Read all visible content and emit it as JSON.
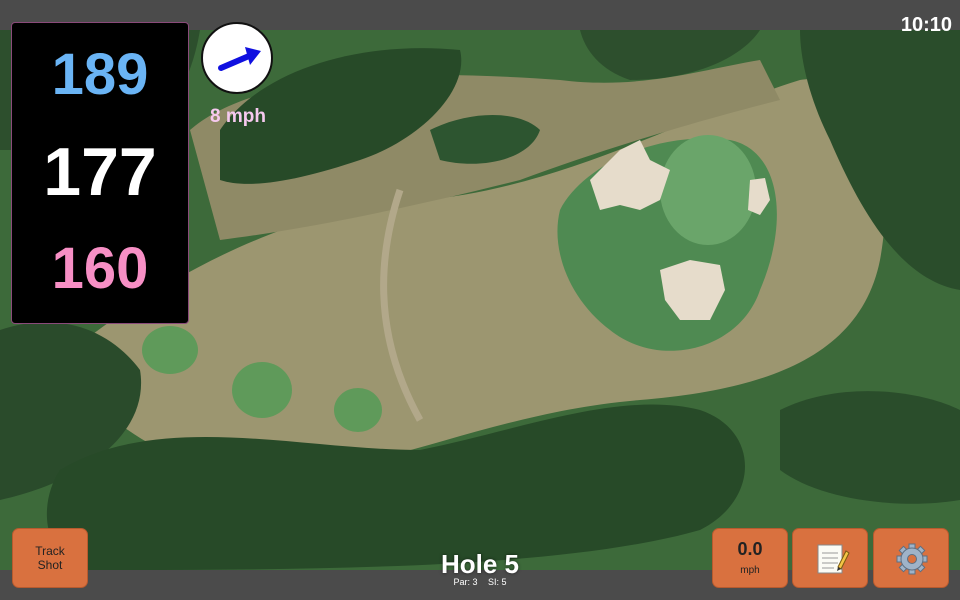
{
  "status": {
    "time": "10:10"
  },
  "distances": {
    "back": "189",
    "middle": "177",
    "front": "160",
    "colors": {
      "back": "#6ab4f5",
      "middle": "#ffffff",
      "front": "#f78fc5"
    }
  },
  "wind": {
    "speed_label": "8 mph",
    "speed_color": "#f6c9ef",
    "arrow_color": "#1010e0",
    "icon": "wind-direction-arrow-icon"
  },
  "buttons": {
    "track_shot": [
      "Track",
      "Shot"
    ],
    "wind_value": "0.0",
    "wind_unit": "mph",
    "notes_icon": "notepad-icon",
    "settings_icon": "gear-icon",
    "accent_color": "#d9713f"
  },
  "hole": {
    "title": "Hole 5",
    "par": "Par: 3",
    "si": "SI: 5"
  }
}
